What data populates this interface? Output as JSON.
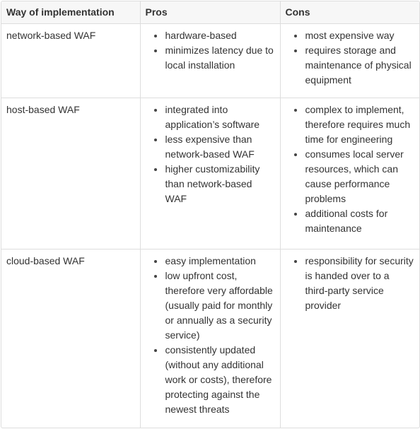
{
  "table": {
    "headers": [
      "Way of implementation",
      "Pros",
      "Cons"
    ],
    "rows": [
      {
        "implementation": "network-based WAF",
        "pros": [
          "hardware-based",
          "minimizes latency due to local installation"
        ],
        "cons": [
          "most expensive way",
          "requires storage and maintenance of physical equipment"
        ]
      },
      {
        "implementation": "host-based WAF",
        "pros": [
          "integrated into application’s software",
          "less expensive than network-based WAF",
          "higher customizability than network-based WAF"
        ],
        "cons": [
          "complex to implement, therefore requires much time for engineering",
          "consumes local server resources, which can cause performance problems",
          "additional costs for maintenance"
        ]
      },
      {
        "implementation": "cloud-based WAF",
        "pros": [
          "easy implementation",
          "low upfront cost, therefore very affordable (usually paid for monthly or annually as a security service)",
          "consistently updated (without any additional work or costs), therefore protecting against the newest threats"
        ],
        "cons": [
          "responsibility for security is handed over to a third-party service provider"
        ]
      }
    ]
  }
}
